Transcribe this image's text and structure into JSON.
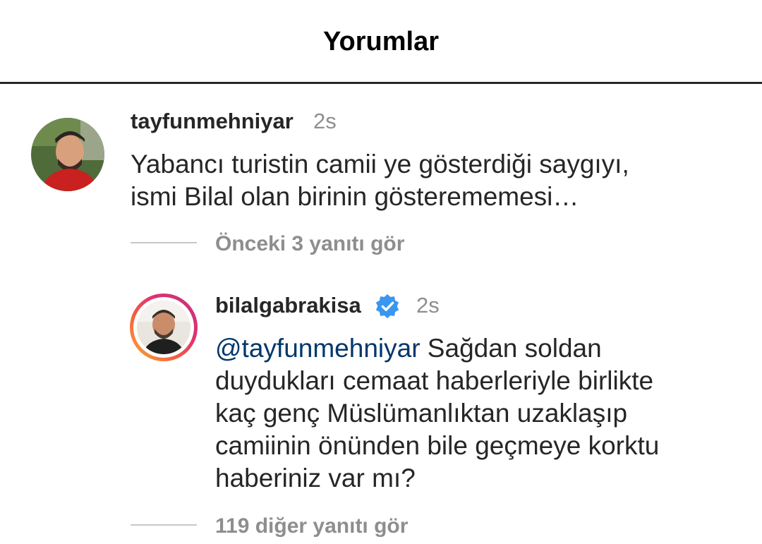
{
  "header": {
    "title": "Yorumlar"
  },
  "comment": {
    "username": "tayfunmehniyar",
    "time": "2s",
    "text_line1": "Yabancı turistin camii ye gösterdiği saygıyı,",
    "text_line2": "ismi Bilal olan birinin gösterememesi…",
    "view_replies": "Önceki 3 yanıtı gör",
    "avatar_icon": "profile-photo-icon"
  },
  "reply": {
    "username": "bilalgabrakisa",
    "time": "2s",
    "verified": true,
    "verified_color": "#3897f0",
    "mention": "@tayfunmehniyar",
    "text_line1_rest": " Sağdan soldan",
    "text_line2": "duydukları cemaat haberleriyle birlikte",
    "text_line3": "kaç genç Müslümanlıktan uzaklaşıp",
    "text_line4": "camiinin önünden bile geçmeye korktu",
    "text_line5": "haberiniz var mı?",
    "view_more_replies": "119 diğer yanıtı gör",
    "avatar_icon": "profile-photo-icon"
  },
  "colors": {
    "text": "#262626",
    "secondary": "#8e8e8e",
    "mention": "#00376b",
    "story_ring_start": "#f9b233",
    "story_ring_end": "#c13584"
  }
}
